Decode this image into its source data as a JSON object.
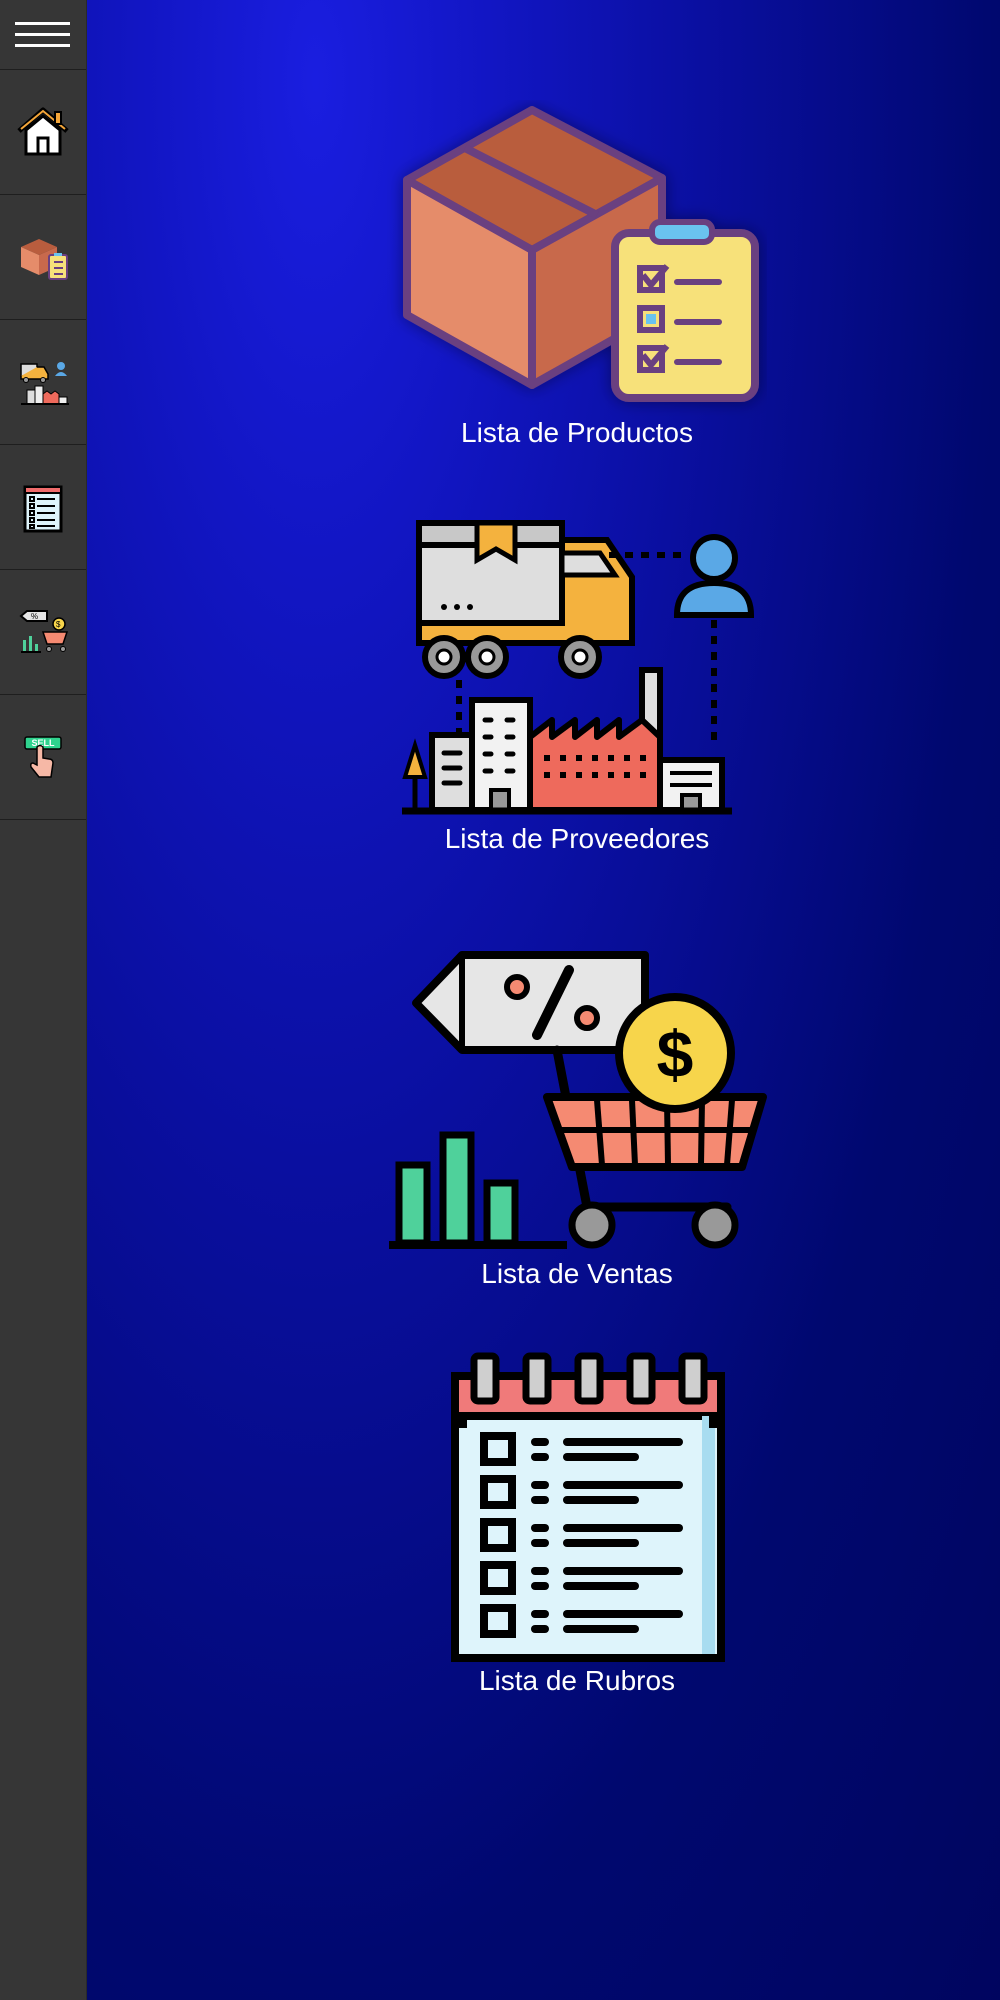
{
  "sidebar": {
    "menu_icon": "hamburger-icon",
    "items": [
      {
        "name": "home",
        "icon": "house-icon"
      },
      {
        "name": "productos",
        "icon": "box-clipboard-icon"
      },
      {
        "name": "proveedores",
        "icon": "truck-factory-icon"
      },
      {
        "name": "rubros",
        "icon": "notepad-checklist-icon"
      },
      {
        "name": "ventas",
        "icon": "price-tag-cart-icon"
      },
      {
        "name": "vender",
        "icon": "sell-hand-icon",
        "badge": "SELL"
      }
    ]
  },
  "cards": [
    {
      "label": "Lista de Productos",
      "icon": "box-clipboard-icon"
    },
    {
      "label": "Lista de Proveedores",
      "icon": "truck-factory-icon"
    },
    {
      "label": "Lista de Ventas",
      "icon": "price-tag-cart-icon"
    },
    {
      "label": "Lista de Rubros",
      "icon": "notepad-checklist-icon"
    }
  ],
  "colors": {
    "sidebar": "#363636",
    "background_dark": "#00086a",
    "background_light": "#1a1ee0",
    "label": "#ffffff"
  }
}
